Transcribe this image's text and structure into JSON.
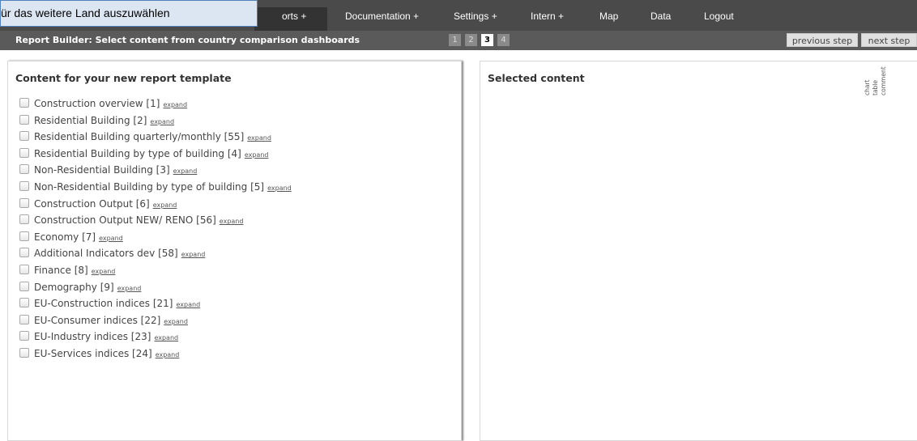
{
  "tooltip": {
    "text": "ür das weitere Land auszuwählen"
  },
  "nav": {
    "items": [
      {
        "label": "orts +"
      },
      {
        "label": "Documentation +"
      },
      {
        "label": "Settings +"
      },
      {
        "label": "Intern +"
      },
      {
        "label": "Map"
      },
      {
        "label": "Data"
      },
      {
        "label": "Logout"
      }
    ]
  },
  "subheader": {
    "title": "Report Builder: Select content from country comparison dashboards",
    "steps": [
      "1",
      "2",
      "3",
      "4"
    ],
    "current_step": "3",
    "previous_label": "previous step",
    "next_label": "next step"
  },
  "left_panel": {
    "title": "Content for your new report template",
    "expand_label": "expand",
    "items": [
      {
        "label": "Construction overview [1]"
      },
      {
        "label": "Residential Building [2]"
      },
      {
        "label": "Residential Building quarterly/monthly [55]"
      },
      {
        "label": "Residential Building by type of building [4]"
      },
      {
        "label": "Non-Residential Building [3]"
      },
      {
        "label": "Non-Residential Building by type of building [5]"
      },
      {
        "label": "Construction Output [6]"
      },
      {
        "label": "Construction Output NEW/ RENO [56]"
      },
      {
        "label": "Economy [7]"
      },
      {
        "label": "Additional Indicators dev [58]"
      },
      {
        "label": "Finance [8]"
      },
      {
        "label": "Demography [9]"
      },
      {
        "label": "EU-Construction indices [21]"
      },
      {
        "label": "EU-Consumer indices [22]"
      },
      {
        "label": "EU-Industry indices [23]"
      },
      {
        "label": "EU-Services indices [24]"
      }
    ]
  },
  "right_panel": {
    "title": "Selected content",
    "columns": [
      "chart",
      "table",
      "comment"
    ]
  }
}
